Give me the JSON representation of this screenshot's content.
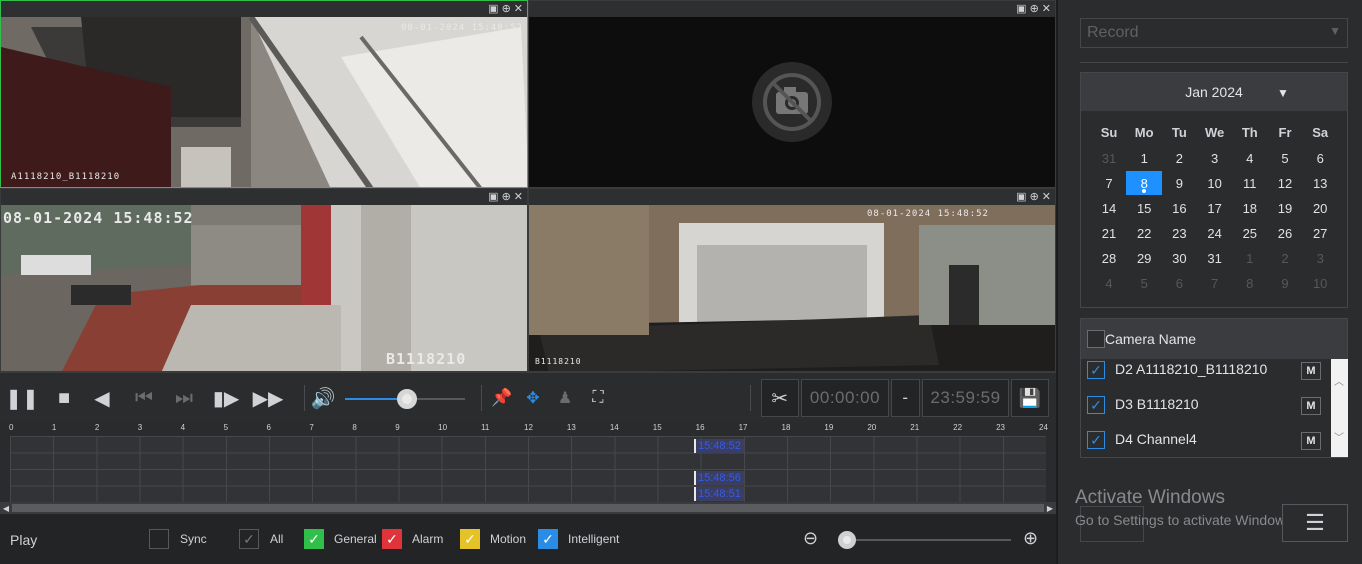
{
  "panes": [
    {
      "osd_time": "08-01-2024 15:48:52",
      "osd_name": "A1118210_B1118210",
      "pane_icons": [
        "snapshot-icon",
        "zoom-icon",
        "close-icon"
      ]
    },
    {
      "no_video": true,
      "pane_icons": [
        "snapshot-icon",
        "zoom-icon",
        "close-icon"
      ]
    },
    {
      "osd_time": "08-01-2024 15:48:52",
      "osd_name": "B1118210",
      "pane_icons": [
        "snapshot-icon",
        "zoom-icon",
        "close-icon"
      ]
    },
    {
      "osd_time": "08-01-2024 15:48:52",
      "osd_name": "B1118210",
      "pane_icons": [
        "snapshot-icon",
        "zoom-icon",
        "close-icon"
      ]
    }
  ],
  "controls": {
    "start_time": "00:00:00",
    "dash": "-",
    "end_time": "23:59:59",
    "volume_level": 0.52
  },
  "timeline": {
    "hours": [
      "0",
      "1",
      "2",
      "3",
      "4",
      "5",
      "6",
      "7",
      "8",
      "9",
      "10",
      "11",
      "12",
      "13",
      "14",
      "15",
      "16",
      "17",
      "18",
      "19",
      "20",
      "21",
      "22",
      "23",
      "24"
    ],
    "marks": [
      "15:48:52",
      "15:48:56",
      "15:48:51"
    ]
  },
  "bottom": {
    "mode_label": "Play",
    "sync_label": "Sync",
    "all_label": "All",
    "general_label": "General",
    "alarm_label": "Alarm",
    "motion_label": "Motion",
    "intelligent_label": "Intelligent",
    "colors": {
      "general": "#2fbf4a",
      "alarm": "#e0343a",
      "motion": "#e6c229",
      "intelligent": "#2b8ce6"
    }
  },
  "side": {
    "record_type": "Record",
    "calendar": {
      "month_label": "Jan 2024",
      "dow": [
        "Su",
        "Mo",
        "Tu",
        "We",
        "Th",
        "Fr",
        "Sa"
      ],
      "weeks": [
        [
          "31",
          "1",
          "2",
          "3",
          "4",
          "5",
          "6"
        ],
        [
          "7",
          "8",
          "9",
          "10",
          "11",
          "12",
          "13"
        ],
        [
          "14",
          "15",
          "16",
          "17",
          "18",
          "19",
          "20"
        ],
        [
          "21",
          "22",
          "23",
          "24",
          "25",
          "26",
          "27"
        ],
        [
          "28",
          "29",
          "30",
          "31",
          "1",
          "2",
          "3"
        ],
        [
          "4",
          "5",
          "6",
          "7",
          "8",
          "9",
          "10"
        ]
      ],
      "selected": "8"
    },
    "camera_list": {
      "header": "Camera Name",
      "items": [
        {
          "name": "D2 A1118210_B1118210",
          "m": "M"
        },
        {
          "name": "D3 B1118210",
          "m": "M"
        },
        {
          "name": "D4 Channel4",
          "m": "M"
        }
      ]
    },
    "watermark_title": "Activate Windows",
    "watermark_sub": "Go to Settings to activate Windows."
  }
}
